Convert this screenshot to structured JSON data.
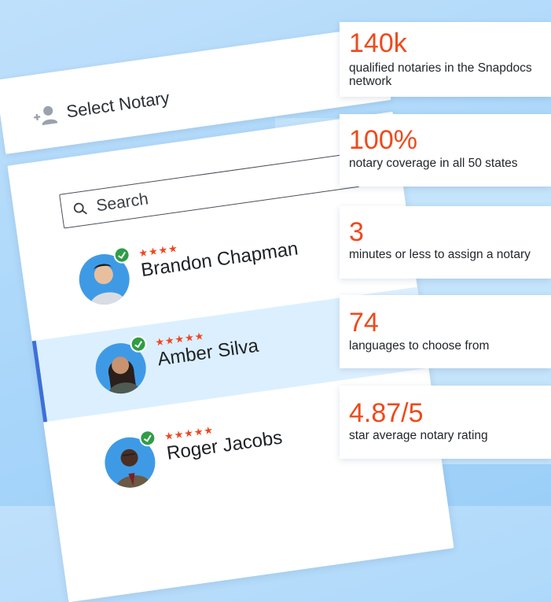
{
  "header": {
    "title": "Select Notary",
    "icon": "add-person-icon"
  },
  "search": {
    "placeholder": "Search"
  },
  "notaries": [
    {
      "name": "Brandon Chapman",
      "stars": "★★★★",
      "selected": false
    },
    {
      "name": "Amber Silva",
      "stars": "★★★★★",
      "selected": true
    },
    {
      "name": "Roger Jacobs",
      "stars": "★★★★★",
      "selected": false
    }
  ],
  "stats": [
    {
      "value": "140k",
      "label": "qualified notaries in the Snapdocs network"
    },
    {
      "value": "100%",
      "label": "notary coverage in all 50 states"
    },
    {
      "value": "3",
      "label": "minutes or less to assign a notary"
    },
    {
      "value": "74",
      "label": "languages to choose from"
    },
    {
      "value": "4.87/5",
      "label": "star average notary rating"
    }
  ],
  "colors": {
    "accent": "#ee4a1c",
    "stars": "#f0461f",
    "selected_bar": "#3e6fd8",
    "selected_row": "#dcefff",
    "verified": "#2f9d46",
    "background": "#a9d6fa"
  }
}
